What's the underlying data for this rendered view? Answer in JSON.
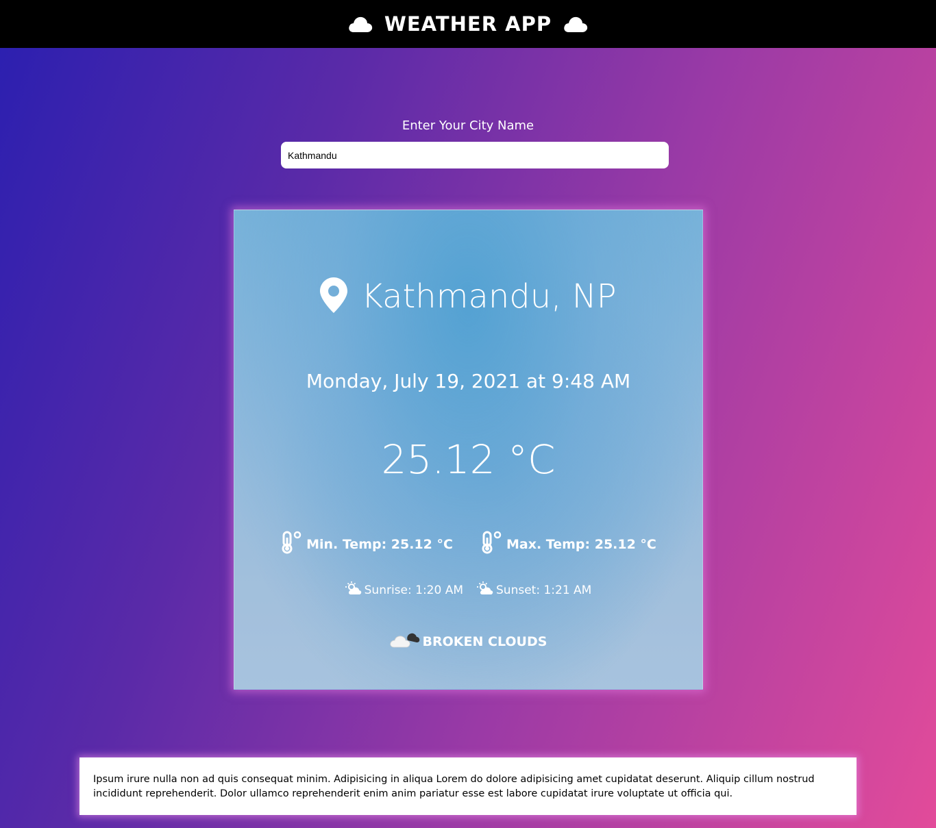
{
  "header": {
    "title": "WEATHER APP",
    "left_icon": "cloud-icon",
    "right_icon": "cloud-icon"
  },
  "search": {
    "label": "Enter Your City Name",
    "value": "Kathmandu",
    "placeholder": ""
  },
  "weather": {
    "location": "Kathmandu, NP",
    "location_icon": "map-pin-icon",
    "datetime": "Monday, July 19, 2021 at 9:48 AM",
    "temperature": "25.12 °C",
    "min_temp": "Min. Temp: 25.12 °C",
    "max_temp": "Max. Temp: 25.12 °C",
    "temp_icon": "thermometer-icon",
    "sunrise": "Sunrise: 1:20 AM",
    "sunset": "Sunset: 1:21 AM",
    "sun_icon": "sun-cloud-icon",
    "condition": "BROKEN CLOUDS",
    "condition_icon": "broken-clouds-icon"
  },
  "footer": {
    "text": "Ipsum irure nulla non ad quis consequat minim. Adipisicing in aliqua Lorem do dolore adipisicing amet cupidatat deserunt. Aliquip cillum nostrud incididunt reprehenderit. Dolor ullamco reprehenderit enim anim pariatur esse est labore cupidatat irure voluptate ut officia qui."
  },
  "colors": {
    "topbar": "#000000",
    "gradient_start": "#2a1fb0",
    "gradient_end": "#e24b9a",
    "text": "#ffffff"
  }
}
